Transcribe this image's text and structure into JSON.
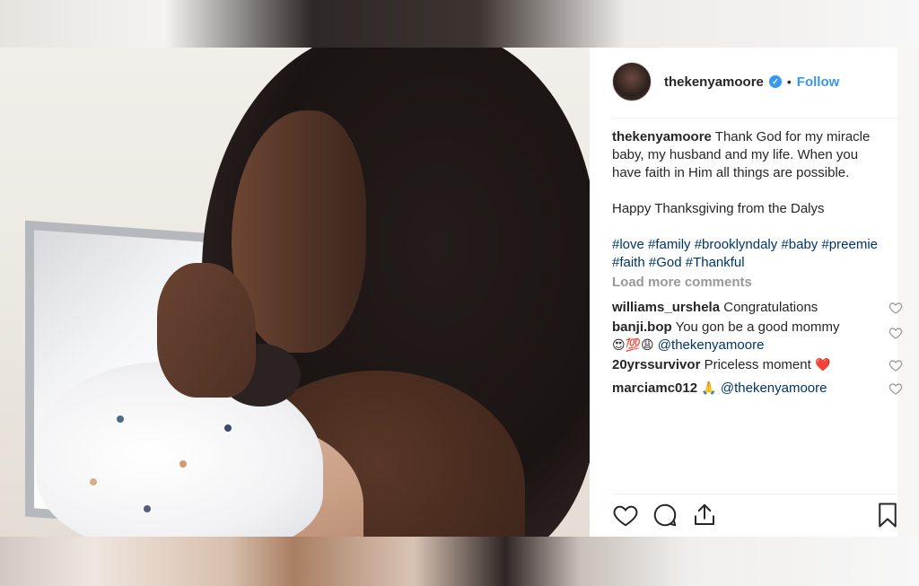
{
  "post": {
    "username": "thekenyamoore",
    "verified_glyph": "✓",
    "bullet": "•",
    "follow_label": "Follow",
    "caption": {
      "username": "thekenyamoore",
      "text": "Thank God for my miracle baby, my husband and my life. When you have faith in Him all things are possible.",
      "line2": "Happy Thanksgiving from the Dalys",
      "hashtags": "#love #family #brooklyndaly #baby #preemie #faith #God #Thankful"
    },
    "load_more_label": "Load more comments",
    "comments": [
      {
        "username": "williams_urshela",
        "text": "Congratulations"
      },
      {
        "username": "banji.bop",
        "text": "You gon be a good mommy",
        "emojis": "😍💯😩",
        "mention": "@thekenyamoore"
      },
      {
        "username": "20yrssurvivor",
        "text": "Priceless moment",
        "emojis": "❤️"
      },
      {
        "username": "marciamc012",
        "emojis": "🙏",
        "mention": "@thekenyamoore"
      }
    ],
    "icons": {
      "like": "heart-icon",
      "comment": "comment-icon",
      "share": "share-icon",
      "save": "bookmark-icon",
      "comment_like": "heart-icon",
      "verified": "verified-badge-icon"
    },
    "colors": {
      "link": "#3897f0",
      "hashtag": "#003569",
      "muted": "#999999",
      "text": "#262626",
      "heart": "#ed4956"
    }
  }
}
